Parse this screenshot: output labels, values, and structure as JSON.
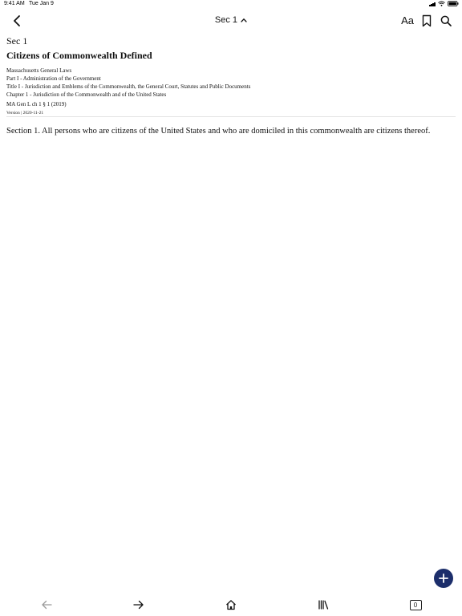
{
  "status_bar": {
    "time": "9:41 AM",
    "date": "Tue Jan 9"
  },
  "nav": {
    "title": "Sec 1",
    "font_label": "Aa",
    "icons": {
      "back": "chevron-left-icon",
      "title_toggle": "chevron-up-icon",
      "bookmark": "bookmark-icon",
      "search": "search-icon"
    }
  },
  "document": {
    "section_label": "Sec 1",
    "title": "Citizens of Commonwealth Defined",
    "meta": [
      "Massachusetts General Laws",
      "Part I - Administration of the Government",
      "Title I - Jurisdiction and Emblems of the Commonwealth, the General Court, Statutes and Public Documents",
      "Chapter 1 - Jurisdiction of the Commonwealth and of the United States"
    ],
    "citation": "MA Gen L ch 1 § 1 (2019)",
    "version": "Version | 2020-11-21",
    "body": "Section 1. All persons who are citizens of the United States and who are domiciled in this commonwealth are citizens thereof."
  },
  "fab": {
    "icon": "plus-icon",
    "color": "#1c2e6b"
  },
  "toolbar": {
    "tabs_count": "0",
    "icons": [
      "arrow-left-icon",
      "arrow-right-icon",
      "home-icon",
      "library-icon",
      "tabs-icon"
    ]
  },
  "colors": {
    "accent": "#1c2e6b",
    "disabled": "#9a9a9a"
  }
}
